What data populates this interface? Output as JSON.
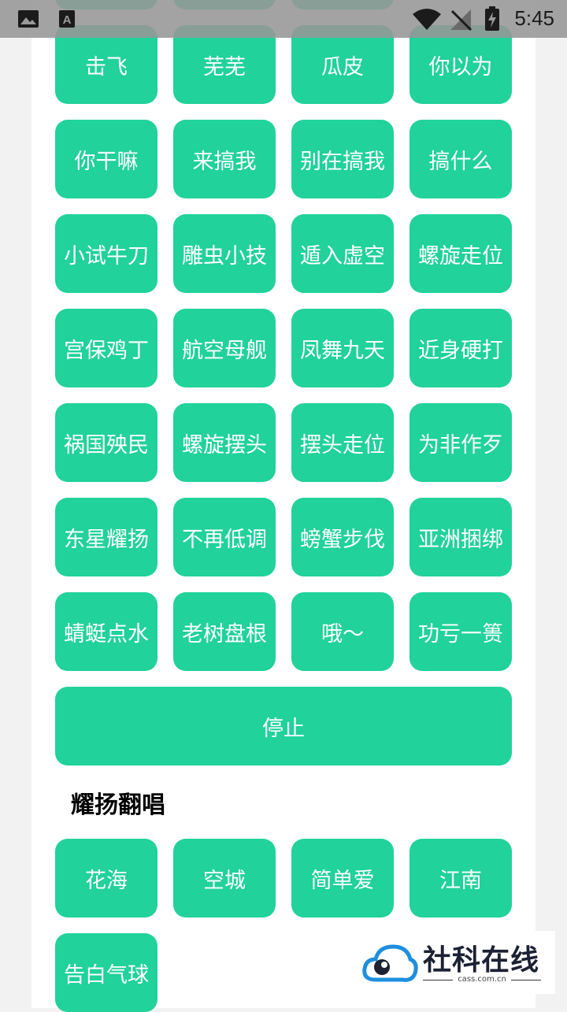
{
  "status_bar": {
    "time": "5:45",
    "icons": [
      "image-icon",
      "font-a-icon",
      "wifi-icon",
      "no-signal-icon",
      "battery-charging-icon"
    ]
  },
  "buttons_top": [
    [
      "击飞",
      "芜芜",
      "瓜皮",
      "你以为"
    ],
    [
      "你干嘛",
      "来搞我",
      "别在搞我",
      "搞什么"
    ],
    [
      "小试牛刀",
      "雕虫小技",
      "遁入虚空",
      "螺旋走位"
    ],
    [
      "宫保鸡丁",
      "航空母舰",
      "凤舞九天",
      "近身硬打"
    ],
    [
      "祸国殃民",
      "螺旋摆头",
      "摆头走位",
      "为非作歹"
    ],
    [
      "东星耀扬",
      "不再低调",
      "螃蟹步伐",
      "亚洲捆绑"
    ],
    [
      "蜻蜓点水",
      "老树盘根",
      "哦～",
      "功亏一篑"
    ]
  ],
  "stop_button": "停止",
  "section_title": "耀扬翻唱",
  "buttons_songs": [
    [
      "花海",
      "空城",
      "简单爱",
      "江南"
    ],
    [
      "告白气球"
    ]
  ],
  "watermark": {
    "text": "社科在线",
    "subtext": "cass.com.cn"
  },
  "colors": {
    "button": "#21d29a",
    "button_text": "#ffffff",
    "background": "#f1f2f1",
    "panel": "#ffffff"
  }
}
